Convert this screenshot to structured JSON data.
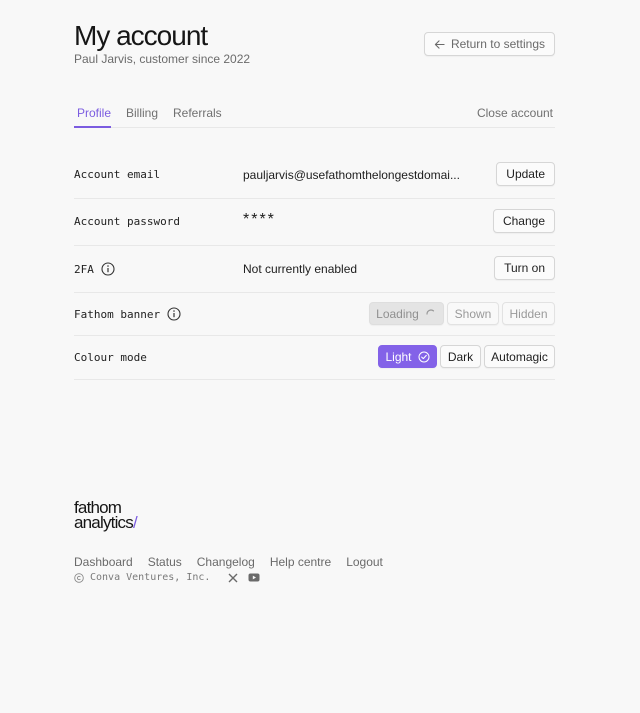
{
  "header": {
    "title": "My account",
    "subtitle": "Paul Jarvis, customer since 2022",
    "return_label": "Return to settings",
    "return_icon": "arrow-left-icon"
  },
  "tabs": {
    "items": [
      {
        "label": "Profile",
        "active": true
      },
      {
        "label": "Billing",
        "active": false
      },
      {
        "label": "Referrals",
        "active": false
      }
    ],
    "close_account": "Close account",
    "accent_color": "#7b5ce0"
  },
  "rows": {
    "email": {
      "label": "Account email",
      "value": "pauljarvis@usefathomthelongestdomai...",
      "action": "Update"
    },
    "password": {
      "label": "Account password",
      "value": "****",
      "action": "Change"
    },
    "twofa": {
      "label": "2FA",
      "value": "Not currently enabled",
      "action": "Turn on",
      "icon": "info-icon"
    },
    "banner": {
      "label": "Fathom banner",
      "icon": "info-icon",
      "options": [
        "Loading",
        "Shown",
        "Hidden"
      ],
      "state": "loading"
    },
    "colour": {
      "label": "Colour mode",
      "options": [
        "Light",
        "Dark",
        "Automagic"
      ],
      "selected": "Light",
      "selected_color": "#8362e8"
    }
  },
  "footer": {
    "logo_line1": "fathom",
    "logo_line2": "analytics",
    "logo_slash": "/",
    "links": [
      "Dashboard",
      "Status",
      "Changelog",
      "Help centre",
      "Logout"
    ],
    "copyright": "Conva Ventures, Inc.",
    "social_icons": [
      "x-icon",
      "youtube-icon"
    ]
  }
}
